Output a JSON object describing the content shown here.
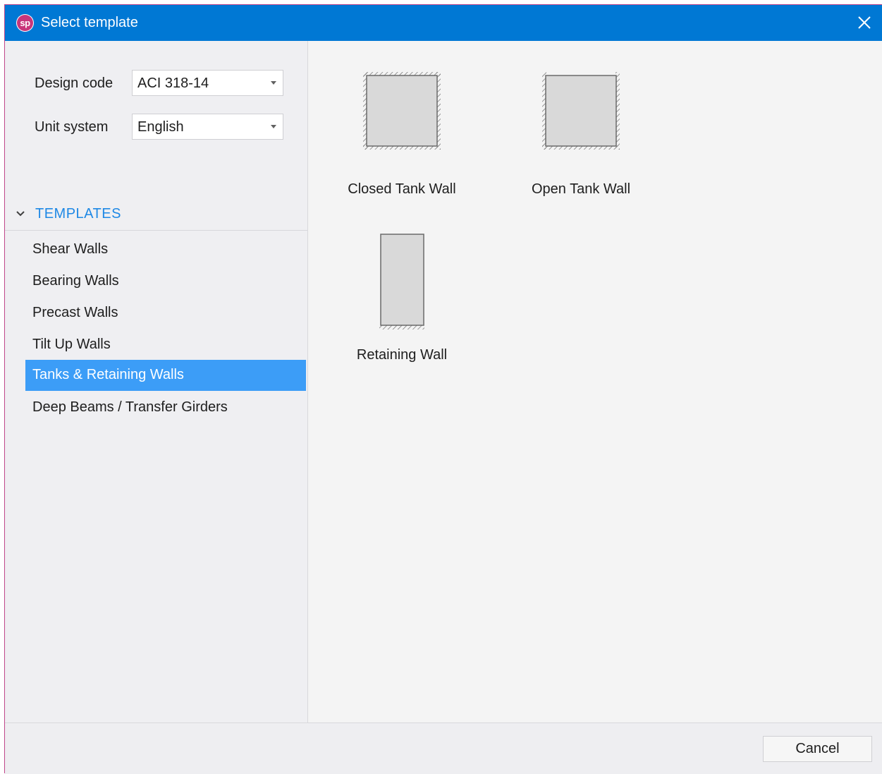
{
  "window": {
    "app_logo_text": "sp",
    "title": "Select template"
  },
  "settings": {
    "design_code_label": "Design code",
    "design_code_value": "ACI 318-14",
    "unit_system_label": "Unit system",
    "unit_system_value": "English"
  },
  "templates": {
    "header": "TEMPLATES",
    "items": [
      {
        "label": "Shear Walls",
        "selected": false
      },
      {
        "label": "Bearing Walls",
        "selected": false
      },
      {
        "label": "Precast Walls",
        "selected": false
      },
      {
        "label": "Tilt Up Walls",
        "selected": false
      },
      {
        "label": "Tanks & Retaining Walls",
        "selected": true
      },
      {
        "label": "Deep Beams / Transfer Girders",
        "selected": false
      }
    ]
  },
  "gallery": {
    "tiles": [
      {
        "label": "Closed Tank Wall",
        "icon": "closed-tank-wall-icon"
      },
      {
        "label": "Open Tank Wall",
        "icon": "open-tank-wall-icon"
      },
      {
        "label": "Retaining Wall",
        "icon": "retaining-wall-icon"
      }
    ]
  },
  "footer": {
    "cancel_label": "Cancel"
  },
  "colors": {
    "title_bar": "#0078d4",
    "accent": "#1e88e5",
    "selection": "#3c9df7",
    "logo": "#c8357a"
  }
}
